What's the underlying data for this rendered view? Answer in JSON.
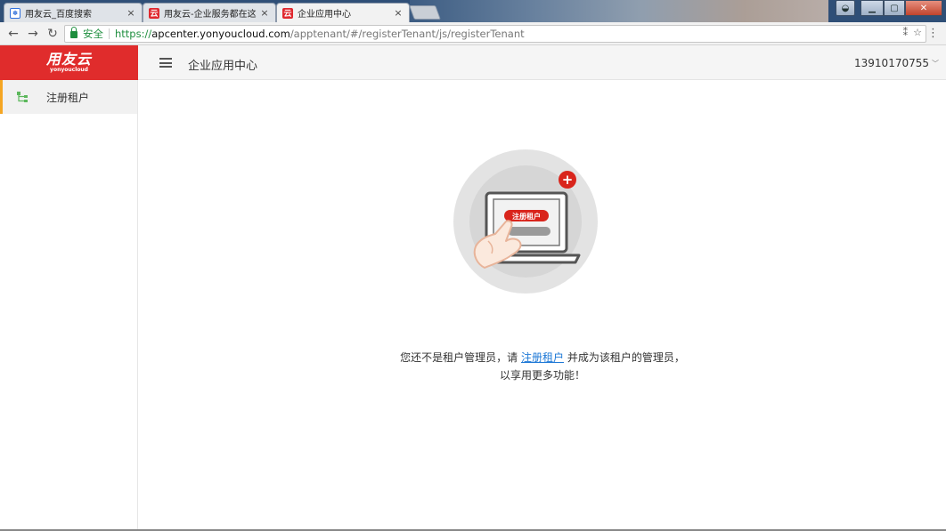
{
  "browser": {
    "tabs": [
      {
        "title": "用友云_百度搜索",
        "favicon": "baidu-paw-icon"
      },
      {
        "title": "用友云-企业服务都在这",
        "favicon": "yonyou-logo-icon"
      },
      {
        "title": "企业应用中心",
        "favicon": "yonyou-logo-icon",
        "active": true
      }
    ],
    "close_glyph": "×",
    "address": {
      "secure_label": "安全",
      "url_scheme": "https://",
      "url_host": "apcenter.yonyoucloud.com",
      "url_path": "/apptenant/#/registerTenant/js/registerTenant"
    }
  },
  "app": {
    "logo": {
      "main": "用友云",
      "sub": "yonyoucloud"
    },
    "header_title": "企业应用中心",
    "user_phone": "13910170755",
    "sidebar": {
      "items": [
        {
          "label": "注册租户",
          "icon": "org-tree-icon",
          "active": true
        }
      ]
    },
    "illustration": {
      "badge_text": "注册租户",
      "plus_glyph": "+"
    },
    "message": {
      "prefix": "您还不是租户管理员，请",
      "link": "注册租户",
      "suffix": "并成为该租户的管理员，",
      "line2": "以享用更多功能！"
    }
  },
  "colors": {
    "brand_red": "#e02c2c",
    "active_accent": "#f5a623",
    "link_blue": "#1d78d6"
  }
}
